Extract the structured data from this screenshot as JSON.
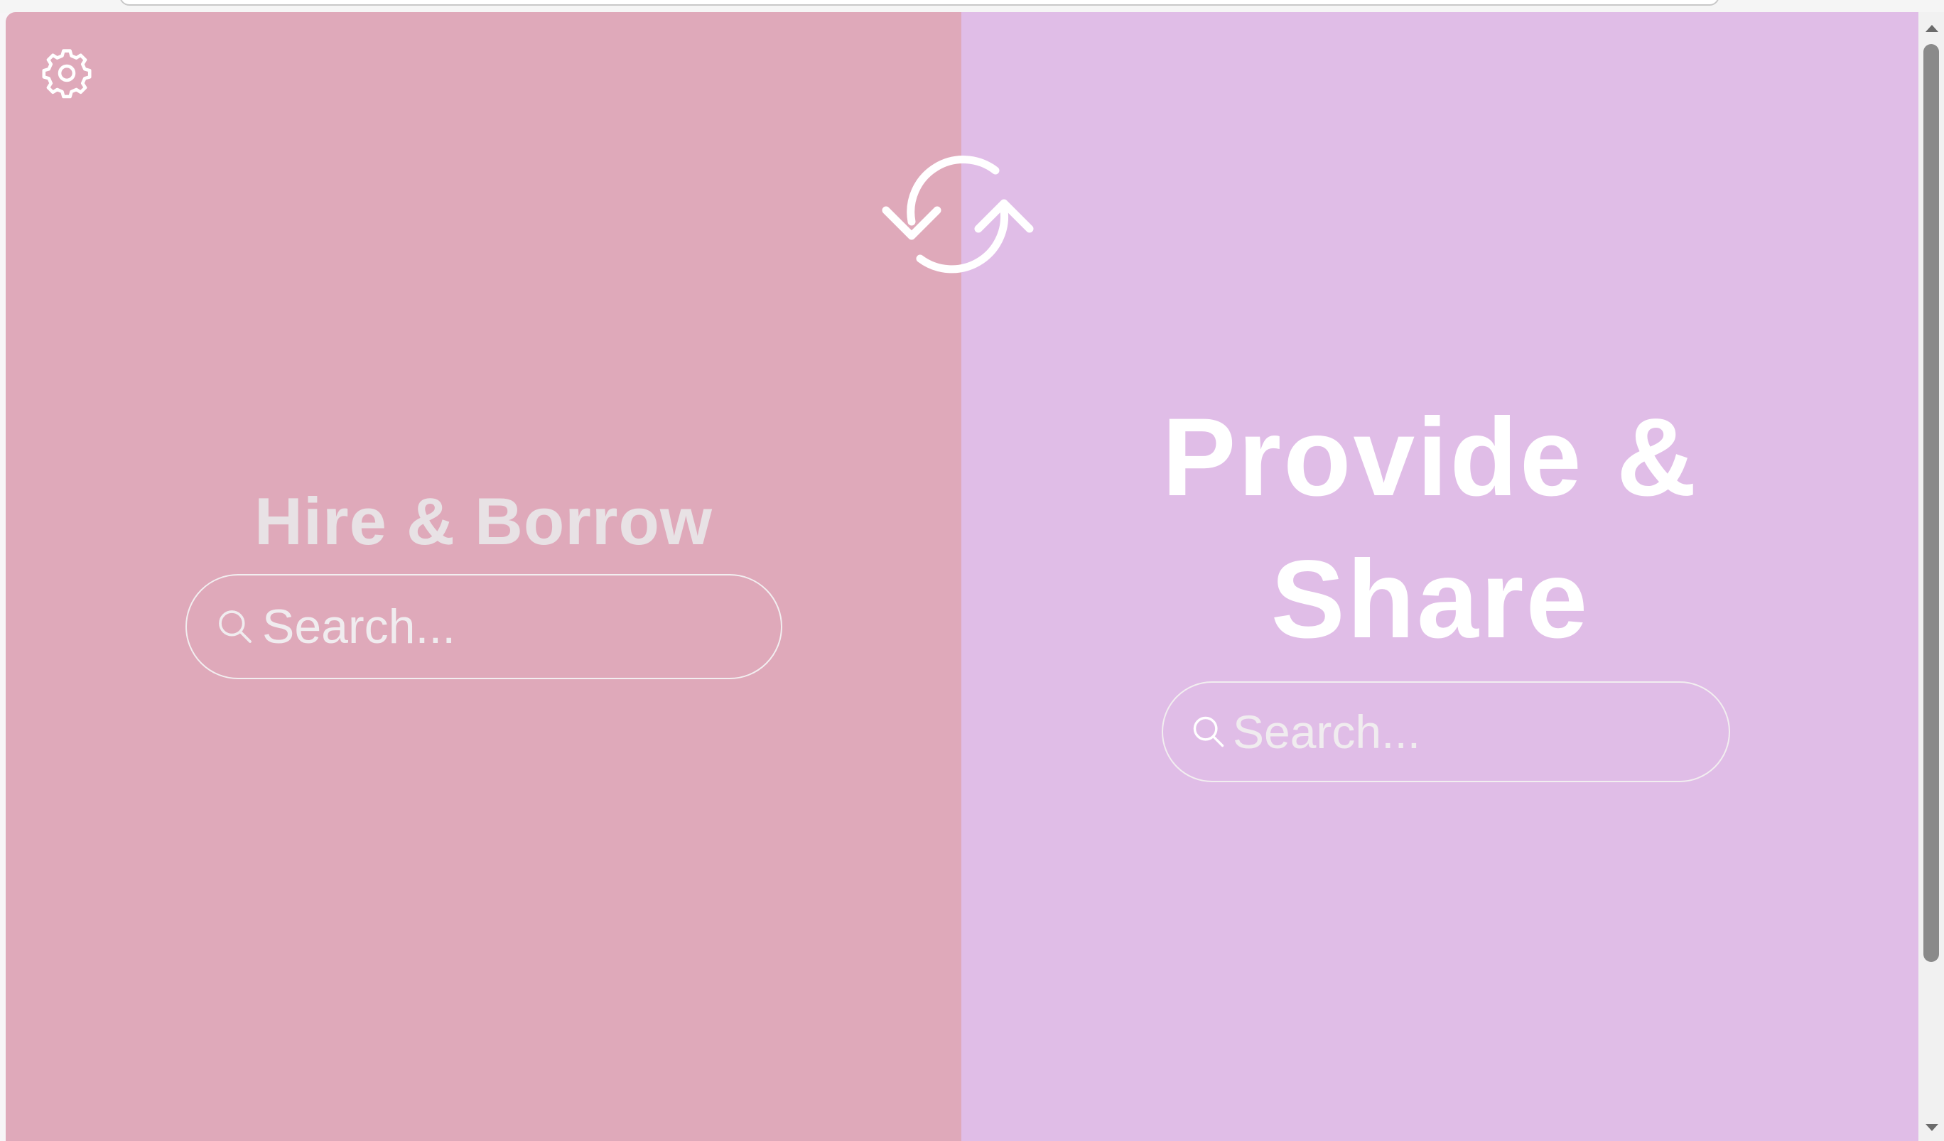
{
  "left_panel": {
    "title": "Hire & Borrow",
    "search": {
      "placeholder": "Search...",
      "value": ""
    },
    "color": "#dfa9ba"
  },
  "right_panel": {
    "title": "Provide & Share",
    "search": {
      "placeholder": "Search...",
      "value": ""
    },
    "color": "#e0bde7"
  },
  "controls": {
    "settings_icon": "gear-icon",
    "swap_icon": "swap-arrows-icon",
    "search_icon": "search-icon"
  }
}
